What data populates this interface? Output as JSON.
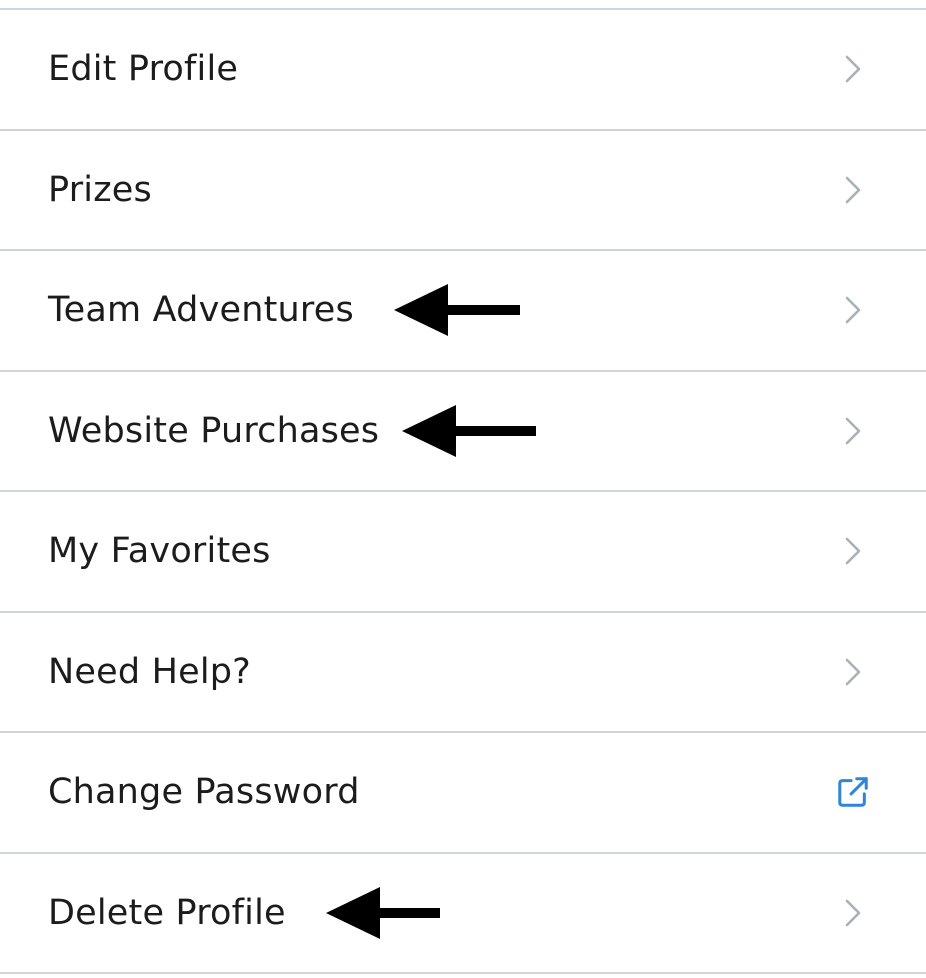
{
  "menu": {
    "items": [
      {
        "label": "Edit Profile",
        "trailing_icon": "chevron-right-icon",
        "annotated": false
      },
      {
        "label": "Prizes",
        "trailing_icon": "chevron-right-icon",
        "annotated": false
      },
      {
        "label": "Team Adventures",
        "trailing_icon": "chevron-right-icon",
        "annotated": true
      },
      {
        "label": "Website Purchases",
        "trailing_icon": "chevron-right-icon",
        "annotated": true
      },
      {
        "label": "My Favorites",
        "trailing_icon": "chevron-right-icon",
        "annotated": false
      },
      {
        "label": "Need Help?",
        "trailing_icon": "chevron-right-icon",
        "annotated": false
      },
      {
        "label": "Change Password",
        "trailing_icon": "external-link-icon",
        "annotated": false
      },
      {
        "label": "Delete Profile",
        "trailing_icon": "chevron-right-icon",
        "annotated": true
      }
    ]
  },
  "colors": {
    "text": "#1c1c1c",
    "divider": "#cfd4da",
    "chevron": "#a9b0b8",
    "external_link": "#2f86d8",
    "annotation_arrow": "#000000"
  }
}
